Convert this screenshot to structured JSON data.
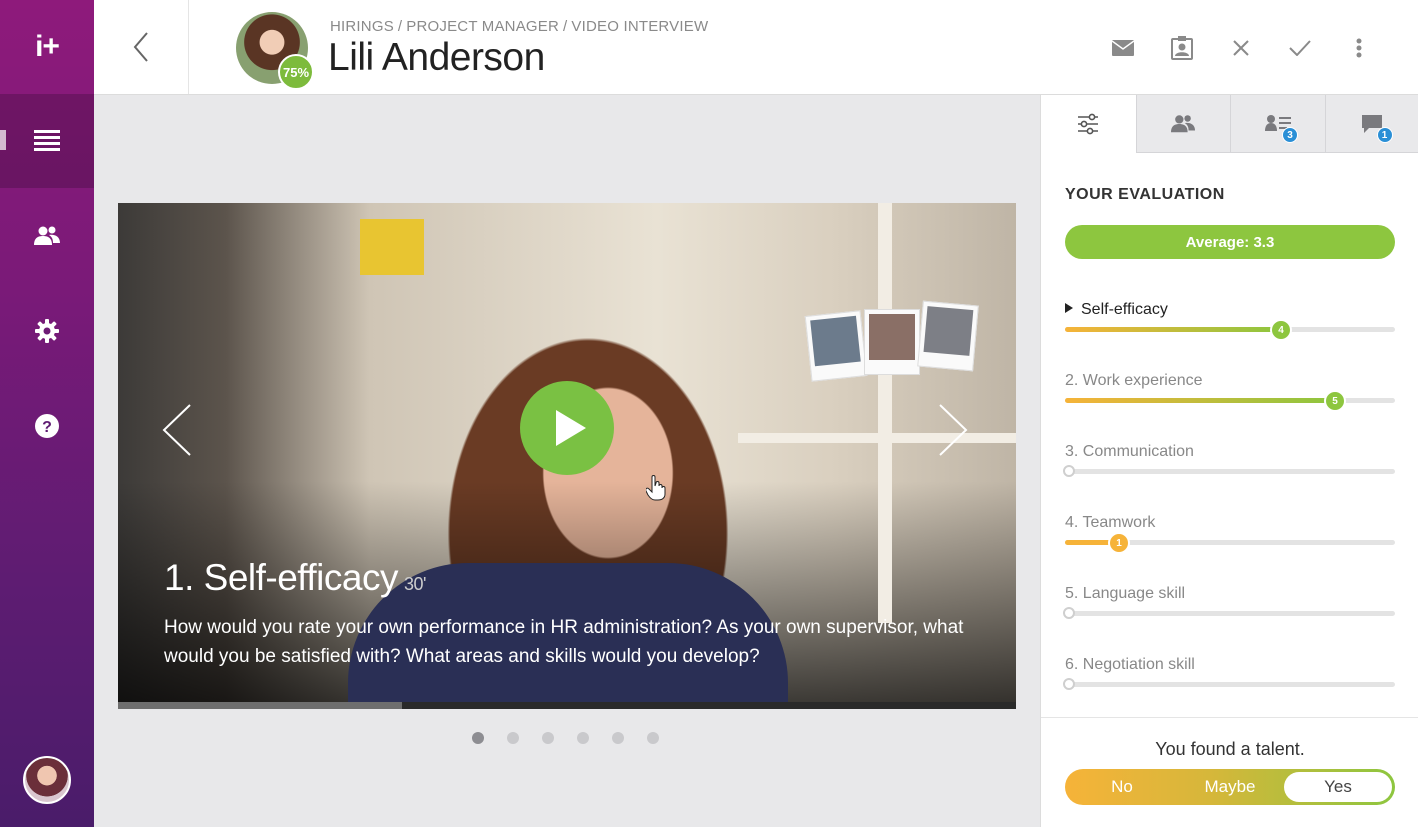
{
  "sidebar": {
    "logo": "i+",
    "items": [
      {
        "name": "list-icon"
      },
      {
        "name": "people-icon"
      },
      {
        "name": "gear-icon"
      },
      {
        "name": "help-icon"
      }
    ]
  },
  "header": {
    "breadcrumb": [
      "HIRINGS",
      "PROJECT MANAGER",
      "VIDEO INTERVIEW"
    ],
    "breadcrumb_sep": "/",
    "candidate_name": "Lili Anderson",
    "match_badge": "75%",
    "actions": [
      "mail-icon",
      "profile-icon",
      "close-icon",
      "check-icon",
      "more-icon"
    ]
  },
  "video": {
    "question_title": "1. Self-efficacy",
    "duration": "30'",
    "question_text": "How would you rate your own performance in HR administration? As your own supervisor, what would you be satisfied with? What areas and skills would you develop?",
    "progress": 0.316,
    "slides_total": 6,
    "slide_active": 0
  },
  "panel": {
    "tabs": [
      {
        "icon": "sliders-icon",
        "badge": ""
      },
      {
        "icon": "people-icon",
        "badge": ""
      },
      {
        "icon": "list-people-icon",
        "badge": "3"
      },
      {
        "icon": "comment-icon",
        "badge": "1"
      }
    ],
    "eval_title": "YOUR EVALUATION",
    "average": "Average: 3.3",
    "criteria": [
      {
        "label": "Self-efficacy",
        "value": "4",
        "score": 4,
        "current": true
      },
      {
        "label": "2. Work experience",
        "value": "5",
        "score": 5,
        "current": false
      },
      {
        "label": "3. Communication",
        "value": "",
        "score": 0,
        "current": false
      },
      {
        "label": "4. Teamwork",
        "value": "1",
        "score": 1,
        "current": false
      },
      {
        "label": "5. Language skill",
        "value": "",
        "score": 0,
        "current": false
      },
      {
        "label": "6. Negotiation skill",
        "value": "",
        "score": 0,
        "current": false
      }
    ],
    "scale_max": 6,
    "talent_title": "You found a talent.",
    "talent_options": [
      "No",
      "Maybe",
      "Yes"
    ],
    "talent_selected": "Yes"
  },
  "colors": {
    "brand_purple": "#8e1a7b",
    "accent_green": "#8dc63f",
    "accent_orange": "#f6b339",
    "badge_blue": "#2a8fd6"
  }
}
